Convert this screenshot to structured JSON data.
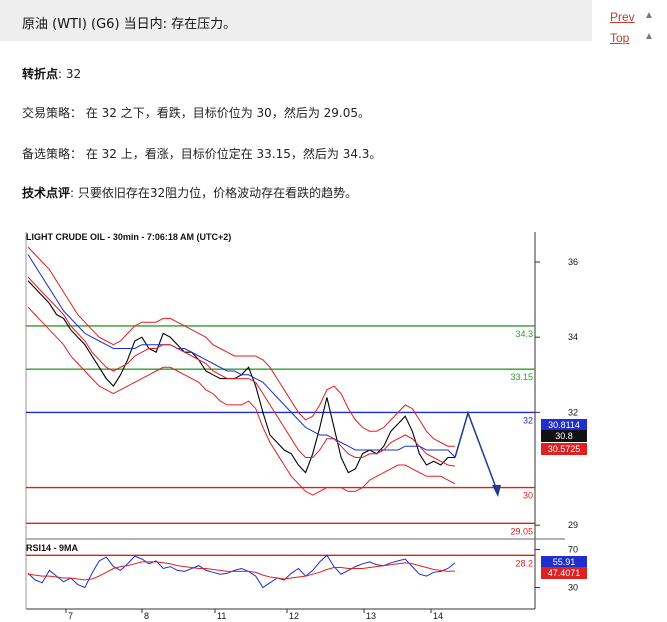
{
  "header": {
    "title": "原油 (WTI) (G6) 当日内: 存在压力。"
  },
  "nav": {
    "prev": "Prev",
    "top": "Top"
  },
  "analysis": {
    "pivot_label": "转折点",
    "pivot_value": ": 32",
    "strategy_label": "交易策略",
    "strategy_text": "： 在 32 之下，看跌，目标价位为 30，然后为 29.05。",
    "alt_label": "备选策略",
    "alt_text": "： 在 32 上，看涨，目标价位定在 33.15，然后为 34.3。",
    "comment_label": "技术点评",
    "comment_text": ": 只要依旧存在32阻力位，价格波动存在看跌的趋势。"
  },
  "chart_data": [
    {
      "type": "line",
      "title": "LIGHT CRUDE OIL - 30min - 7:06:18 AM (UTC+2)",
      "x_ticks": [
        "7",
        "8",
        "11",
        "12",
        "13",
        "14"
      ],
      "y_ticks": [
        36,
        34,
        32,
        29
      ],
      "ylim": [
        27.9,
        36.5
      ],
      "levels": [
        {
          "value": 34.3,
          "label": "34.3",
          "color": "#2e9e2e"
        },
        {
          "value": 33.15,
          "label": "33.15",
          "color": "#2e9e2e"
        },
        {
          "value": 32,
          "label": "32",
          "color": "#1f2ecc"
        },
        {
          "value": 30,
          "label": "30",
          "color": "#e02020"
        },
        {
          "value": 29.05,
          "label": "29.05",
          "color": "#e02020"
        },
        {
          "value": 28.2,
          "label": "28.2",
          "color": "#e02020"
        }
      ],
      "price_tags": [
        {
          "value": 30.8114,
          "label": "30.8114",
          "color": "#1f2ecc"
        },
        {
          "value": 30.8,
          "label": "30.8",
          "color": "#111111"
        },
        {
          "value": 30.5725,
          "label": "30.5725",
          "color": "#e02020"
        }
      ],
      "series": [
        {
          "values": [
            35.5,
            35.3,
            35.1,
            34.9,
            34.6,
            34.5,
            34.2,
            34.0,
            33.8,
            33.5,
            33.2,
            32.9,
            32.7,
            33.0,
            33.4,
            33.9,
            34.0,
            33.7,
            33.6,
            34.1,
            34.0,
            33.8,
            33.6,
            33.6,
            33.4,
            33.1,
            33.0,
            32.9,
            32.9,
            32.9,
            33.0,
            33.2,
            32.7,
            32.0,
            31.4,
            31.2,
            31.0,
            30.9,
            30.6,
            30.4,
            30.9,
            31.6,
            32.4,
            31.6,
            30.8,
            30.4,
            30.5,
            30.9,
            31.0,
            30.9,
            31.1,
            31.5,
            31.7,
            31.9,
            31.5,
            30.9,
            30.6,
            30.7,
            30.6,
            30.8,
            30.8
          ]
        },
        {
          "values": [
            36.2,
            35.9,
            35.6,
            35.3,
            35.0,
            34.7,
            34.5,
            34.3,
            34.1,
            34.0,
            33.9,
            33.8,
            33.7,
            33.7,
            33.7,
            33.7,
            33.8,
            33.8,
            33.8,
            33.8,
            33.8,
            33.7,
            33.7,
            33.6,
            33.5,
            33.4,
            33.3,
            33.2,
            33.1,
            33.1,
            33.0,
            33.0,
            32.9,
            32.8,
            32.6,
            32.4,
            32.2,
            32.0,
            31.8,
            31.6,
            31.5,
            31.4,
            31.4,
            31.3,
            31.2,
            31.1,
            31.0,
            31.0,
            31.0,
            31.0,
            31.0,
            31.0,
            31.0,
            31.1,
            31.1,
            31.1,
            31.0,
            31.0,
            31.0,
            31.0,
            30.81
          ]
        },
        {
          "values": [
            35.6,
            35.4,
            35.2,
            35.0,
            34.8,
            34.6,
            34.3,
            34.1,
            33.9,
            33.6,
            33.4,
            33.2,
            33.1,
            33.2,
            33.3,
            33.5,
            33.6,
            33.7,
            33.7,
            33.8,
            33.8,
            33.7,
            33.6,
            33.5,
            33.4,
            33.3,
            33.1,
            33.0,
            32.9,
            32.9,
            32.9,
            32.9,
            32.8,
            32.5,
            32.2,
            31.9,
            31.6,
            31.3,
            31.0,
            30.8,
            30.8,
            31.0,
            31.3,
            31.3,
            31.1,
            30.9,
            30.8,
            30.8,
            30.9,
            30.9,
            31.0,
            31.2,
            31.3,
            31.4,
            31.3,
            31.1,
            30.9,
            30.8,
            30.7,
            30.6,
            30.5725
          ]
        },
        {
          "values": [
            36.4,
            36.2,
            36.0,
            35.8,
            35.5,
            35.2,
            34.9,
            34.6,
            34.4,
            34.2,
            34.0,
            33.9,
            33.8,
            33.9,
            34.1,
            34.3,
            34.4,
            34.4,
            34.4,
            34.5,
            34.5,
            34.4,
            34.3,
            34.2,
            34.1,
            34.0,
            33.8,
            33.7,
            33.6,
            33.5,
            33.5,
            33.5,
            33.5,
            33.4,
            33.2,
            32.9,
            32.6,
            32.3,
            32.0,
            31.8,
            31.9,
            32.2,
            32.6,
            32.7,
            32.5,
            32.1,
            31.8,
            31.6,
            31.5,
            31.5,
            31.6,
            31.8,
            32.0,
            32.2,
            32.1,
            31.8,
            31.5,
            31.3,
            31.2,
            31.1,
            31.1
          ]
        },
        {
          "values": [
            34.8,
            34.6,
            34.4,
            34.2,
            34.0,
            33.8,
            33.5,
            33.3,
            33.1,
            32.9,
            32.7,
            32.6,
            32.5,
            32.6,
            32.7,
            32.8,
            32.9,
            33.0,
            33.1,
            33.2,
            33.2,
            33.1,
            33.0,
            32.9,
            32.8,
            32.6,
            32.5,
            32.3,
            32.2,
            32.2,
            32.2,
            32.3,
            32.1,
            31.6,
            31.2,
            30.9,
            30.6,
            30.3,
            30.1,
            29.9,
            29.8,
            29.9,
            30.0,
            30.0,
            30.0,
            29.9,
            29.9,
            30.0,
            30.2,
            30.3,
            30.4,
            30.5,
            30.6,
            30.6,
            30.5,
            30.4,
            30.3,
            30.3,
            30.3,
            30.2,
            30.1
          ]
        }
      ]
    },
    {
      "type": "line",
      "title": "RSI14 - 9MA",
      "y_ticks": [
        70,
        30
      ],
      "ylim": [
        20,
        80
      ],
      "price_tags": [
        {
          "value": 55.91,
          "label": "55.91",
          "color": "#1f2ecc"
        },
        {
          "value": 47.4071,
          "label": "47.4071",
          "color": "#e02020"
        }
      ],
      "series": [
        {
          "values": [
            45,
            38,
            35,
            48,
            42,
            36,
            40,
            33,
            30,
            45,
            58,
            62,
            52,
            48,
            55,
            63,
            60,
            55,
            58,
            50,
            52,
            48,
            47,
            50,
            53,
            48,
            46,
            44,
            45,
            48,
            50,
            47,
            42,
            30,
            35,
            40,
            38,
            45,
            50,
            42,
            48,
            57,
            64,
            52,
            44,
            48,
            52,
            55,
            57,
            54,
            53,
            56,
            58,
            60,
            52,
            44,
            42,
            46,
            47,
            50,
            55.91
          ]
        },
        {
          "values": [
            44,
            43,
            42,
            42,
            41,
            40,
            40,
            39,
            38,
            39,
            42,
            46,
            50,
            52,
            53,
            55,
            57,
            57,
            57,
            56,
            55,
            53,
            52,
            51,
            50,
            50,
            49,
            48,
            47,
            47,
            47,
            47,
            46,
            43,
            41,
            40,
            39,
            40,
            41,
            42,
            44,
            46,
            49,
            51,
            51,
            50,
            50,
            50,
            51,
            52,
            53,
            54,
            55,
            56,
            55,
            53,
            51,
            49,
            48,
            47,
            47.4071
          ]
        }
      ]
    }
  ]
}
